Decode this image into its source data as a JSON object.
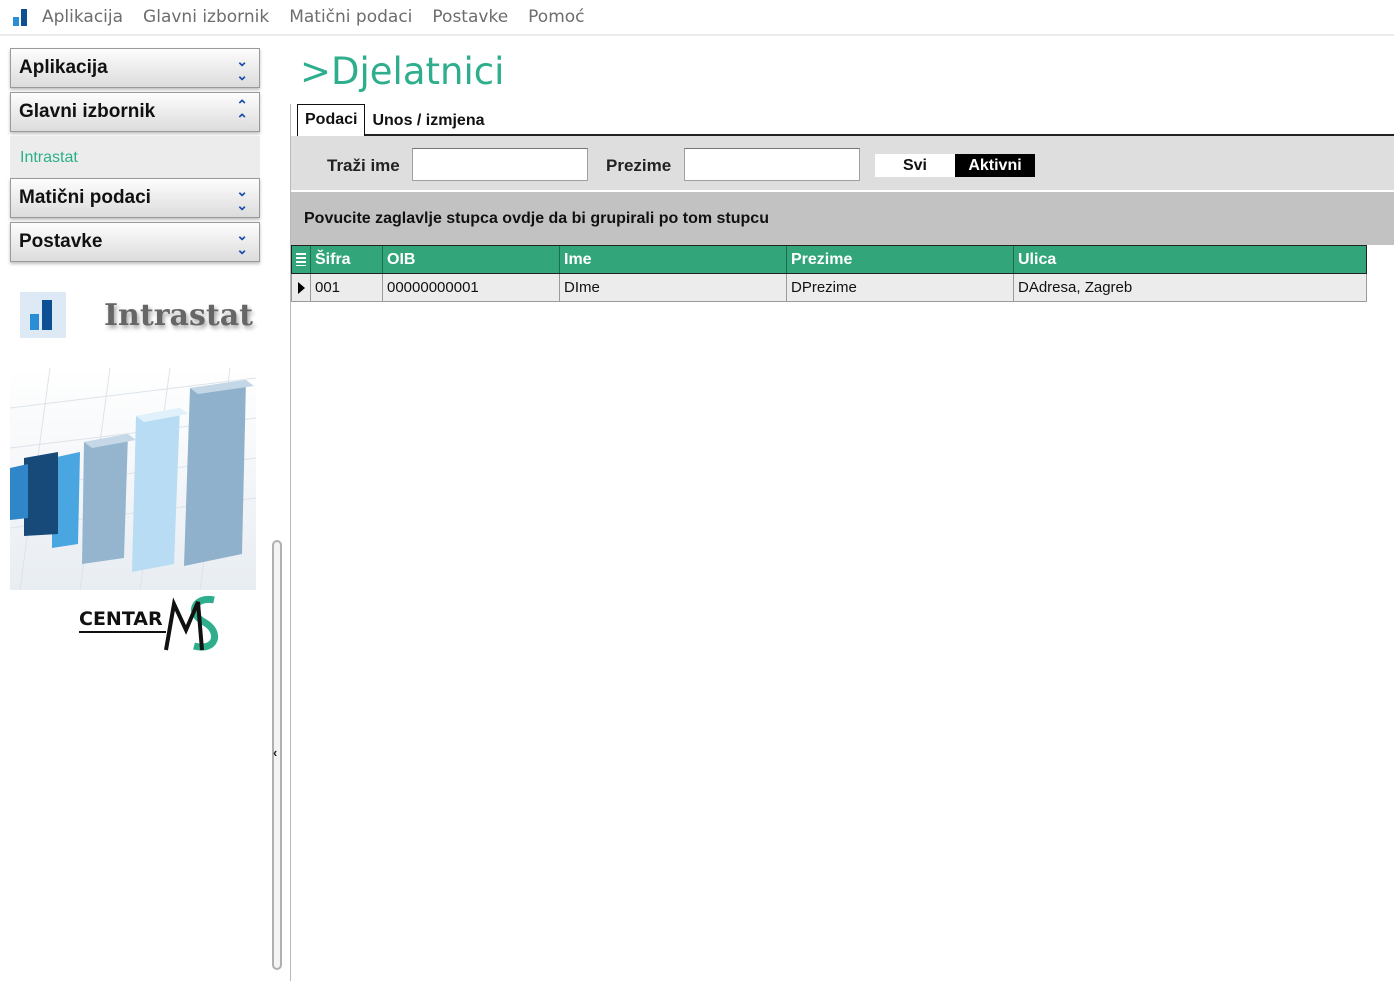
{
  "menu": {
    "items": [
      "Aplikacija",
      "Glavni izbornik",
      "Matični podaci",
      "Postavke",
      "Pomoć"
    ]
  },
  "sidebar": {
    "sections": [
      {
        "title": "Aplikacija",
        "state": "collapsed"
      },
      {
        "title": "Glavni izbornik",
        "state": "expanded",
        "links": [
          "Intrastat"
        ]
      },
      {
        "title": "Matični podaci",
        "state": "collapsed"
      },
      {
        "title": "Postavke",
        "state": "collapsed"
      }
    ],
    "logo_text": "Intrastat",
    "brand_text": "CENTAR",
    "brand_mark": "MCS"
  },
  "page": {
    "title": ">Djelatnici",
    "tabs": [
      {
        "label": "Podaci",
        "active": true
      },
      {
        "label": "Unos / izmjena",
        "active": false
      }
    ]
  },
  "filters": {
    "name_label": "Traži ime",
    "name_value": "",
    "surname_label": "Prezime",
    "surname_value": "",
    "toggle_all": "Svi",
    "toggle_active": "Aktivni",
    "selected": "Aktivni"
  },
  "grid": {
    "group_hint": "Povucite zaglavlje stupca ovdje da bi grupirali po tom stupcu",
    "columns": [
      "Šifra",
      "OIB",
      "Ime",
      "Prezime",
      "Ulica"
    ],
    "rows": [
      [
        "001",
        "00000000001",
        "DIme",
        "DPrezime",
        "DAdresa, Zagreb"
      ]
    ]
  },
  "colors": {
    "accent_green": "#2eae8c",
    "grid_header": "#33a57a",
    "link_green": "#2bb08a",
    "chevron_blue": "#1a4fa8"
  }
}
